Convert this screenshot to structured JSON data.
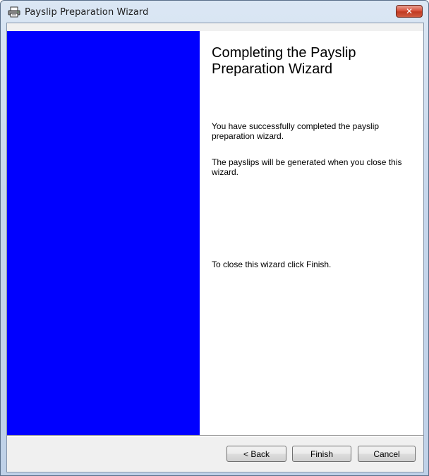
{
  "window": {
    "title": "Payslip Preparation Wizard",
    "icon": "printer-icon",
    "close_label": "✕"
  },
  "colors": {
    "banner": "#0000ff",
    "content_bg": "#ffffff",
    "chrome_bg": "#f0f0f0"
  },
  "page": {
    "heading": "Completing the Payslip Preparation Wizard",
    "paragraph_1": "You have successfully completed the payslip preparation wizard.",
    "paragraph_2": "The payslips will be generated when you close this wizard.",
    "paragraph_3": "To close this wizard click Finish."
  },
  "buttons": {
    "back": "< Back",
    "finish": "Finish",
    "cancel": "Cancel"
  }
}
